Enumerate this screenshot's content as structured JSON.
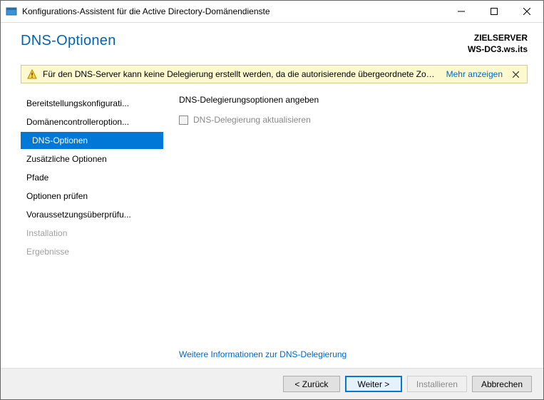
{
  "window": {
    "title": "Konfigurations-Assistent für die Active Directory-Domänendienste"
  },
  "header": {
    "page_title": "DNS-Optionen",
    "target_label": "ZIELSERVER",
    "target_name": "WS-DC3.ws.its"
  },
  "notification": {
    "message": "Für den DNS-Server kann keine Delegierung erstellt werden, da die autorisierende übergeordnete Zone...",
    "more_link": "Mehr anzeigen"
  },
  "nav": {
    "items": [
      {
        "label": "Bereitstellungskonfigurati...",
        "state": "normal"
      },
      {
        "label": "Domänencontrolleroption...",
        "state": "normal"
      },
      {
        "label": "DNS-Optionen",
        "state": "selected"
      },
      {
        "label": "Zusätzliche Optionen",
        "state": "normal"
      },
      {
        "label": "Pfade",
        "state": "normal"
      },
      {
        "label": "Optionen prüfen",
        "state": "normal"
      },
      {
        "label": "Voraussetzungsüberprüfu...",
        "state": "normal"
      },
      {
        "label": "Installation",
        "state": "disabled"
      },
      {
        "label": "Ergebnisse",
        "state": "disabled"
      }
    ]
  },
  "content": {
    "heading": "DNS-Delegierungsoptionen angeben",
    "checkbox_label": "DNS-Delegierung aktualisieren",
    "checkbox_checked": false,
    "checkbox_enabled": false,
    "more_info_link": "Weitere Informationen zur DNS-Delegierung"
  },
  "footer": {
    "back": "< Zurück",
    "next": "Weiter >",
    "install": "Installieren",
    "cancel": "Abbrechen"
  }
}
